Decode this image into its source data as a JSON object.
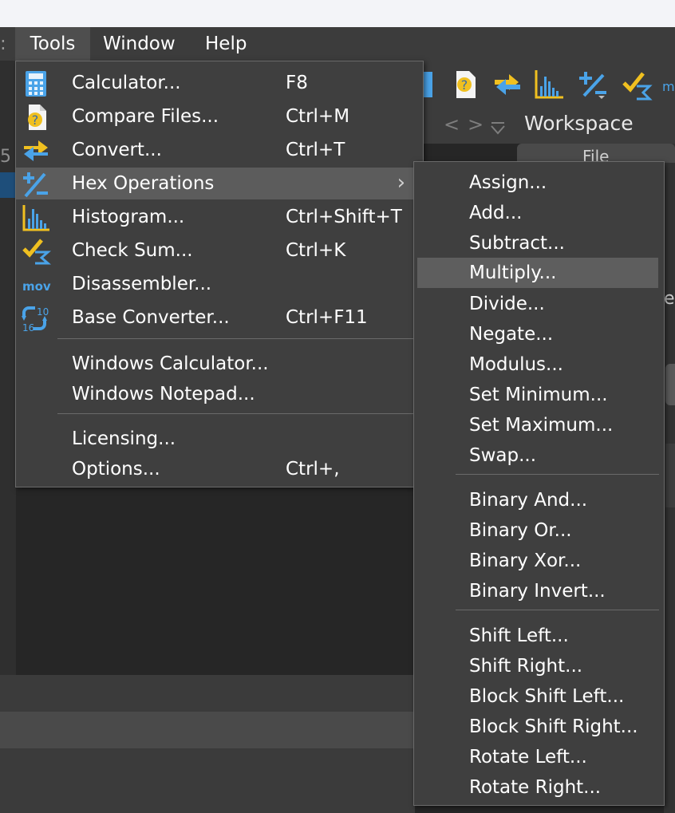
{
  "menubar": {
    "items": [
      {
        "label": "Tools"
      },
      {
        "label": "Window"
      },
      {
        "label": "Help"
      }
    ]
  },
  "workspace": {
    "title": "Workspace",
    "nav_back": "<",
    "nav_forward": ">",
    "nav_dropdown": "v"
  },
  "right_panel": {
    "tab_label": "File",
    "fragment": "es"
  },
  "gutter": {
    "line_number": "5"
  },
  "tools_menu": {
    "items": [
      {
        "label": "Calculator...",
        "shortcut": "F8",
        "icon": "calculator-icon"
      },
      {
        "label": "Compare Files...",
        "shortcut": "Ctrl+M",
        "icon": "compare-files-icon"
      },
      {
        "label": "Convert...",
        "shortcut": "Ctrl+T",
        "icon": "convert-icon"
      },
      {
        "label": "Hex Operations",
        "shortcut": "",
        "icon": "hex-operations-icon"
      },
      {
        "label": "Histogram...",
        "shortcut": "Ctrl+Shift+T",
        "icon": "histogram-icon"
      },
      {
        "label": "Check Sum...",
        "shortcut": "Ctrl+K",
        "icon": "checksum-icon"
      },
      {
        "label": "Disassembler...",
        "shortcut": "",
        "icon": "disassembler-icon",
        "icon_text": "mov"
      },
      {
        "label": "Base Converter...",
        "shortcut": "Ctrl+F11",
        "icon": "base-converter-icon",
        "icon_text_top": "10",
        "icon_text_bottom": "16"
      },
      {
        "label": "Windows Calculator...",
        "shortcut": ""
      },
      {
        "label": "Windows Notepad...",
        "shortcut": ""
      },
      {
        "label": "Licensing...",
        "shortcut": ""
      },
      {
        "label": "Options...",
        "shortcut": "Ctrl+,"
      }
    ]
  },
  "hex_menu": {
    "items": [
      {
        "label": "Assign..."
      },
      {
        "label": "Add..."
      },
      {
        "label": "Subtract..."
      },
      {
        "label": "Multiply..."
      },
      {
        "label": "Divide..."
      },
      {
        "label": "Negate..."
      },
      {
        "label": "Modulus..."
      },
      {
        "label": "Set Minimum..."
      },
      {
        "label": "Set Maximum..."
      },
      {
        "label": "Swap..."
      },
      {
        "label": "Binary And..."
      },
      {
        "label": "Binary Or..."
      },
      {
        "label": "Binary Xor..."
      },
      {
        "label": "Binary Invert..."
      },
      {
        "label": "Shift Left..."
      },
      {
        "label": "Shift Right..."
      },
      {
        "label": "Block Shift Left..."
      },
      {
        "label": "Block Shift Right..."
      },
      {
        "label": "Rotate Left..."
      },
      {
        "label": "Rotate Right..."
      }
    ]
  },
  "colors": {
    "menu_bg": "#3f3f3f",
    "highlight": "#5c5c5c",
    "icon_blue": "#4aa3e8",
    "icon_yellow": "#f0c020"
  }
}
